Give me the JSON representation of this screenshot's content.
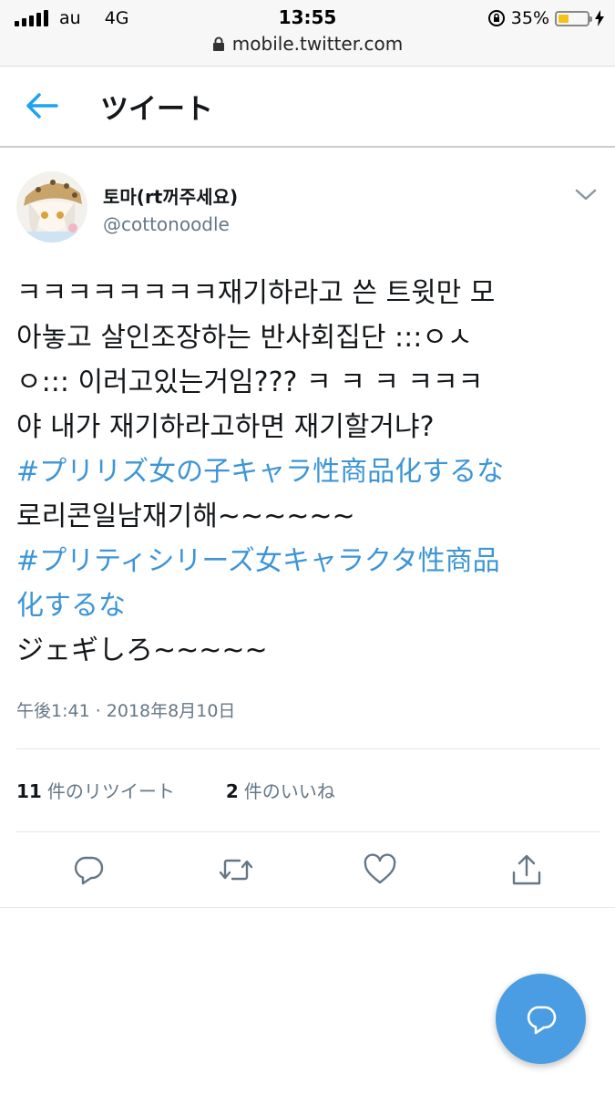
{
  "status_bar": {
    "carrier": "au",
    "network": "4G",
    "time": "13:55",
    "battery_percent": "35%",
    "battery_level": 0.35,
    "url": "mobile.twitter.com"
  },
  "header": {
    "title": "ツイート",
    "back_icon": "arrow-left-icon"
  },
  "tweet": {
    "display_name": "토마(rt꺼주세요)",
    "handle": "@cottonoodle",
    "text_lines": [
      {
        "text": "ㅋㅋㅋㅋㅋㅋㅋㅋ재기하라고 쓴 트윗만 모",
        "hashtag": false
      },
      {
        "text": "아놓고 살인조장하는 반사회집단 :::ㅇㅅ",
        "hashtag": false
      },
      {
        "text": "ㅇ::: 이러고있는거임??? ㅋ ㅋ ㅋ ㅋㅋㅋ",
        "hashtag": false
      },
      {
        "text": "야 내가 재기하라고하면 재기할거냐?",
        "hashtag": false
      },
      {
        "text": "#プリリズ女の子キャラ性商品化するな",
        "hashtag": true
      },
      {
        "text": "로리콘일남재기해~~~~~~",
        "hashtag": false
      },
      {
        "text": "#プリティシリーズ女キャラクタ性商品",
        "hashtag": true
      },
      {
        "text": "化するな",
        "hashtag": true
      },
      {
        "text": "ジェギしろ~~~~~",
        "hashtag": false
      }
    ],
    "timestamp": "午後1:41 · 2018年8月10日",
    "retweets_count": "11",
    "retweets_label": "件のリツイート",
    "likes_count": "2",
    "likes_label": "件のいいね"
  },
  "actions": [
    "reply-icon",
    "retweet-icon",
    "like-icon",
    "share-icon"
  ],
  "fab": {
    "icon": "compose-icon"
  },
  "colors": {
    "accent": "#1da1f2",
    "hashtag": "#3d95d6",
    "secondary_text": "#657786",
    "fab": "#4a9de2"
  }
}
